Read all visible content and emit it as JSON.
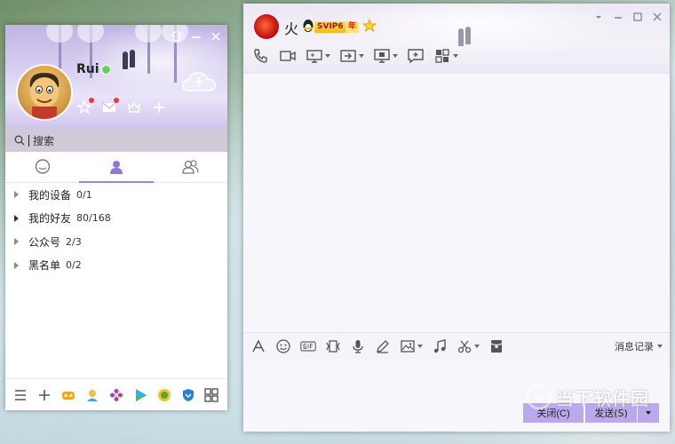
{
  "main_panel": {
    "username": "Rui",
    "search_placeholder": "搜索",
    "contact_groups": [
      {
        "name": "我的设备",
        "count": "0/1"
      },
      {
        "name": "我的好友",
        "count": "80/168"
      },
      {
        "name": "公众号",
        "count": "2/3"
      },
      {
        "name": "黑名单",
        "count": "0/2"
      }
    ],
    "tabs": [
      "message-tab",
      "contacts-tab",
      "groups-tab"
    ],
    "bottom_icons": [
      "menu-icon",
      "add-icon",
      "game-icon",
      "qzone-icon",
      "flower-icon",
      "video-play-icon",
      "coin-icon",
      "shield-icon",
      "apps-grid-icon"
    ]
  },
  "chat_window": {
    "contact_name": "火",
    "svip_badge": "SVIP6",
    "year_badge": "年",
    "close_button": "关闭(C)",
    "send_button": "发送(S)",
    "history_label": "消息记录",
    "header_tools": [
      "phone-icon",
      "video-call-icon",
      "screen-share-icon",
      "file-transfer-icon",
      "remote-desktop-icon",
      "add-conversation-icon",
      "more-apps-icon"
    ],
    "input_tools": [
      "font-icon",
      "emoji-icon",
      "gif-icon",
      "screenshot-icon",
      "voice-icon",
      "handwrite-icon",
      "image-icon",
      "music-icon",
      "scissors-icon",
      "red-packet-icon"
    ]
  },
  "watermark": {
    "text": "当下软件园"
  },
  "colors": {
    "accent": "#9b86d8",
    "button_bg": "#bba9ee",
    "online": "#5fd35a"
  }
}
